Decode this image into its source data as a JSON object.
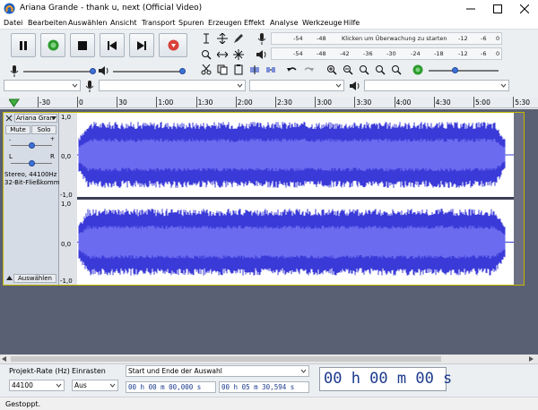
{
  "window": {
    "title": "Ariana Grande - thank u, next (Official Video)"
  },
  "menu": [
    "Datei",
    "Bearbeiten",
    "Auswählen",
    "Ansicht",
    "Transport",
    "Spuren",
    "Erzeugen",
    "Effekt",
    "Analyse",
    "Werkzeuge",
    "Hilfe"
  ],
  "meters": {
    "record_scale": [
      "-54",
      "-48",
      "Klicken um Überwachung zu starten",
      "-12",
      "-6",
      "0"
    ],
    "play_scale": [
      "-54",
      "-48",
      "-42",
      "-36",
      "-30",
      "-24",
      "-18",
      "-12",
      "-6",
      "0"
    ]
  },
  "ruler": {
    "labels": [
      "-30",
      "0",
      "30",
      "1:00",
      "1:30",
      "2:00",
      "2:30",
      "3:00",
      "3:30",
      "4:00",
      "4:30",
      "5:00",
      "5:30"
    ]
  },
  "track": {
    "name": "Ariana Gran",
    "mute": "Mute",
    "solo": "Solo",
    "pan_left": "L",
    "pan_right": "R",
    "info_line1": "Stereo, 44100Hz",
    "info_line2": "32-Bit-Fließkomma",
    "select_label": "Auswählen",
    "scale_top": "1,0",
    "scale_mid": "0,0",
    "scale_bottom": "-1,0"
  },
  "selection_toolbar": {
    "project_rate_label": "Projekt-Rate (Hz)",
    "project_rate_value": "44100",
    "snap_label": "Einrasten",
    "snap_value": "Aus",
    "selection_mode": "Start und Ende der Auswahl",
    "start_time": "00 h 00 m 00,000 s",
    "end_time": "00 h 05 m 30,594 s",
    "audio_position": "00 h 00 m 00 s"
  },
  "status": {
    "text": "Gestoppt."
  },
  "colors": {
    "waveform": "#3a3ad8",
    "waveform_rms": "#6b6bf0",
    "track_bg": "#ffffff",
    "selected_border": "#c4b500",
    "empty_area": "#5a6074"
  }
}
